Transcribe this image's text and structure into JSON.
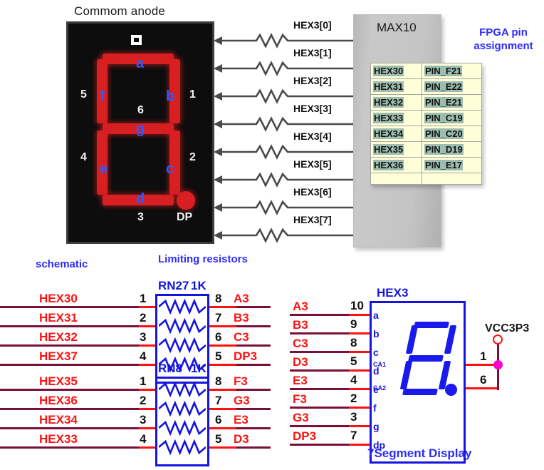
{
  "titles": {
    "common_anode": "Commom anode",
    "fpga_assignment": "FPGA pin\nassignment",
    "max10": "MAX10",
    "schematic": "schematic",
    "limiting_resistors": "Limiting resistors",
    "seven_segment_display": "7Segment Display",
    "vcc": "VCC3P3"
  },
  "colors": {
    "blue_label": "#2b2bff",
    "schematic_blue": "#1414e0",
    "net_red": "#ff1111",
    "net_maroon": "#7a1038",
    "segment_red": "#d81f21",
    "table_cell_bg": "#feffd9",
    "table_highlight": "#9dbdb0",
    "panel_gray": "#c4c4c4",
    "junction_magenta": "#ff00cc"
  },
  "display_photo": {
    "segment_letters": [
      "a",
      "b",
      "c",
      "d",
      "e",
      "f",
      "g"
    ],
    "pin_numbers": [
      "1",
      "2",
      "3",
      "4",
      "5",
      "6"
    ],
    "decimal_point_label": "DP",
    "marker_icon": "square-marker-icon"
  },
  "resistor_rows": [
    {
      "signal": "HEX3[0]"
    },
    {
      "signal": "HEX3[1]"
    },
    {
      "signal": "HEX3[2]"
    },
    {
      "signal": "HEX3[3]"
    },
    {
      "signal": "HEX3[4]"
    },
    {
      "signal": "HEX3[5]"
    },
    {
      "signal": "HEX3[6]"
    },
    {
      "signal": "HEX3[7]"
    }
  ],
  "pin_table": {
    "rows": [
      {
        "signal": "HEX30",
        "pin": "PIN_F21"
      },
      {
        "signal": "HEX31",
        "pin": "PIN_E22"
      },
      {
        "signal": "HEX32",
        "pin": "PIN_E21"
      },
      {
        "signal": "HEX33",
        "pin": "PIN_C19"
      },
      {
        "signal": "HEX34",
        "pin": "PIN_C20"
      },
      {
        "signal": "HEX35",
        "pin": "PIN_D19"
      },
      {
        "signal": "HEX36",
        "pin": "PIN_E17"
      }
    ]
  },
  "rn27": {
    "ref": "RN27",
    "value": "1K",
    "rows": [
      {
        "left_net": "HEX30",
        "left_pin": "1",
        "right_pin": "8",
        "right_net": "A3"
      },
      {
        "left_net": "HEX31",
        "left_pin": "2",
        "right_pin": "7",
        "right_net": "B3"
      },
      {
        "left_net": "HEX32",
        "left_pin": "3",
        "right_pin": "6",
        "right_net": "C3"
      },
      {
        "left_net": "HEX37",
        "left_pin": "4",
        "right_pin": "5",
        "right_net": "DP3"
      }
    ]
  },
  "rn8": {
    "ref": "RN8",
    "value": "1K",
    "rows": [
      {
        "left_net": "HEX35",
        "left_pin": "1",
        "right_pin": "8",
        "right_net": "F3"
      },
      {
        "left_net": "HEX36",
        "left_pin": "2",
        "right_pin": "7",
        "right_net": "G3"
      },
      {
        "left_net": "HEX34",
        "left_pin": "3",
        "right_pin": "6",
        "right_net": "E3"
      },
      {
        "left_net": "HEX33",
        "left_pin": "4",
        "right_pin": "5",
        "right_net": "D3"
      }
    ]
  },
  "hex3": {
    "ref": "HEX3",
    "rows": [
      {
        "net": "A3",
        "pin": "10",
        "seg": "a"
      },
      {
        "net": "B3",
        "pin": "9",
        "seg": "b"
      },
      {
        "net": "C3",
        "pin": "8",
        "seg": "c"
      },
      {
        "net": "D3",
        "pin": "5",
        "seg": "d"
      },
      {
        "net": "E3",
        "pin": "4",
        "seg": "e"
      },
      {
        "net": "F3",
        "pin": "2",
        "seg": "f"
      },
      {
        "net": "G3",
        "pin": "3",
        "seg": "g"
      },
      {
        "net": "DP3",
        "pin": "7",
        "seg": "dp"
      }
    ],
    "common_anode": [
      {
        "label": "CA1",
        "pin": "1"
      },
      {
        "label": "CA2",
        "pin": "6"
      }
    ]
  }
}
